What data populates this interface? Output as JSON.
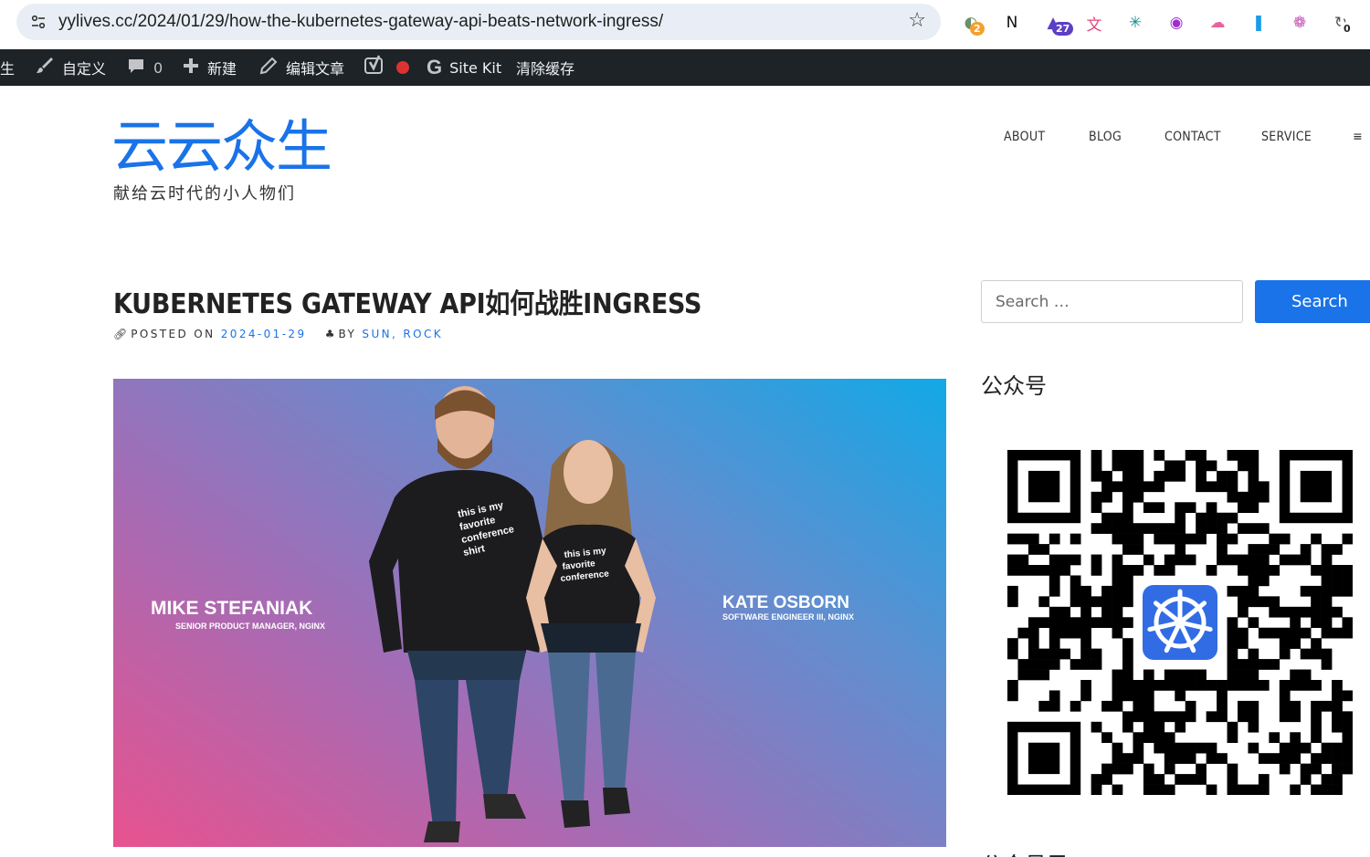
{
  "browser": {
    "url": "yylives.cc/2024/01/29/how-the-kubernetes-gateway-api-beats-network-ingress/",
    "extensions": [
      {
        "name": "chatgpt-ext-icon",
        "glyph": "◐",
        "badge": "2",
        "color": "#6b8e6b",
        "badge_color": "#f2a12e"
      },
      {
        "name": "notion-icon",
        "glyph": "N",
        "badge": "",
        "color": "#111111",
        "badge_color": ""
      },
      {
        "name": "graduation-icon",
        "glyph": "▲",
        "badge": "27",
        "color": "#5b3fc4",
        "badge_color": "#5b3fc4"
      },
      {
        "name": "translate-icon",
        "glyph": "文",
        "badge": "",
        "color": "#e6457a",
        "badge_color": ""
      },
      {
        "name": "network-icon",
        "glyph": "✳",
        "badge": "",
        "color": "#1a8a8a",
        "badge_color": ""
      },
      {
        "name": "reader-icon",
        "glyph": "◉",
        "badge": "",
        "color": "#9b2fd0",
        "badge_color": ""
      },
      {
        "name": "cloud-icon",
        "glyph": "☁",
        "badge": "",
        "color": "#e8639b",
        "badge_color": ""
      },
      {
        "name": "bookmark-icon",
        "glyph": "❚",
        "badge": "",
        "color": "#1a9be8",
        "badge_color": ""
      },
      {
        "name": "openai-icon",
        "glyph": "❁",
        "badge": "",
        "color": "#c04db0",
        "badge_color": ""
      },
      {
        "name": "sync-icon",
        "glyph": "↻",
        "badge": "0",
        "color": "#555555",
        "badge_color": "#ffffff"
      }
    ]
  },
  "adminbar": {
    "site": "生",
    "customize": "自定义",
    "comments_count": "0",
    "new": "新建",
    "edit_post": "编辑文章",
    "sitekit": "Site Kit",
    "clear_cache": "清除缓存"
  },
  "header": {
    "site_title": "云云众生",
    "site_description": "献给云时代的小人物们",
    "nav": [
      "ABOUT",
      "BLOG",
      "CONTACT",
      "SERVICE"
    ],
    "menu_glyph": "≡"
  },
  "post": {
    "title": "KUBERNETES GATEWAY API如何战胜INGRESS",
    "posted_on_label": "POSTED ON",
    "date": "2024-01-29",
    "by_label": "BY",
    "author": "SUN, ROCK",
    "image": {
      "person1_name": "MIKE STEFANIAK",
      "person1_title": "SENIOR PRODUCT MANAGER, NGINX",
      "person2_name": "KATE OSBORN",
      "person2_title": "SOFTWARE ENGINEER III, NGINX",
      "shirt1_text": "this is my favorite conference shirt",
      "shirt2_text": "this is my favorite conference shirt"
    }
  },
  "sidebar": {
    "search_placeholder": "Search …",
    "search_button": "Search",
    "widget1_title": "公众号",
    "widget2_title": "公众号己"
  },
  "colors": {
    "accent": "#1a73e8",
    "adminbar": "#1d2327"
  }
}
